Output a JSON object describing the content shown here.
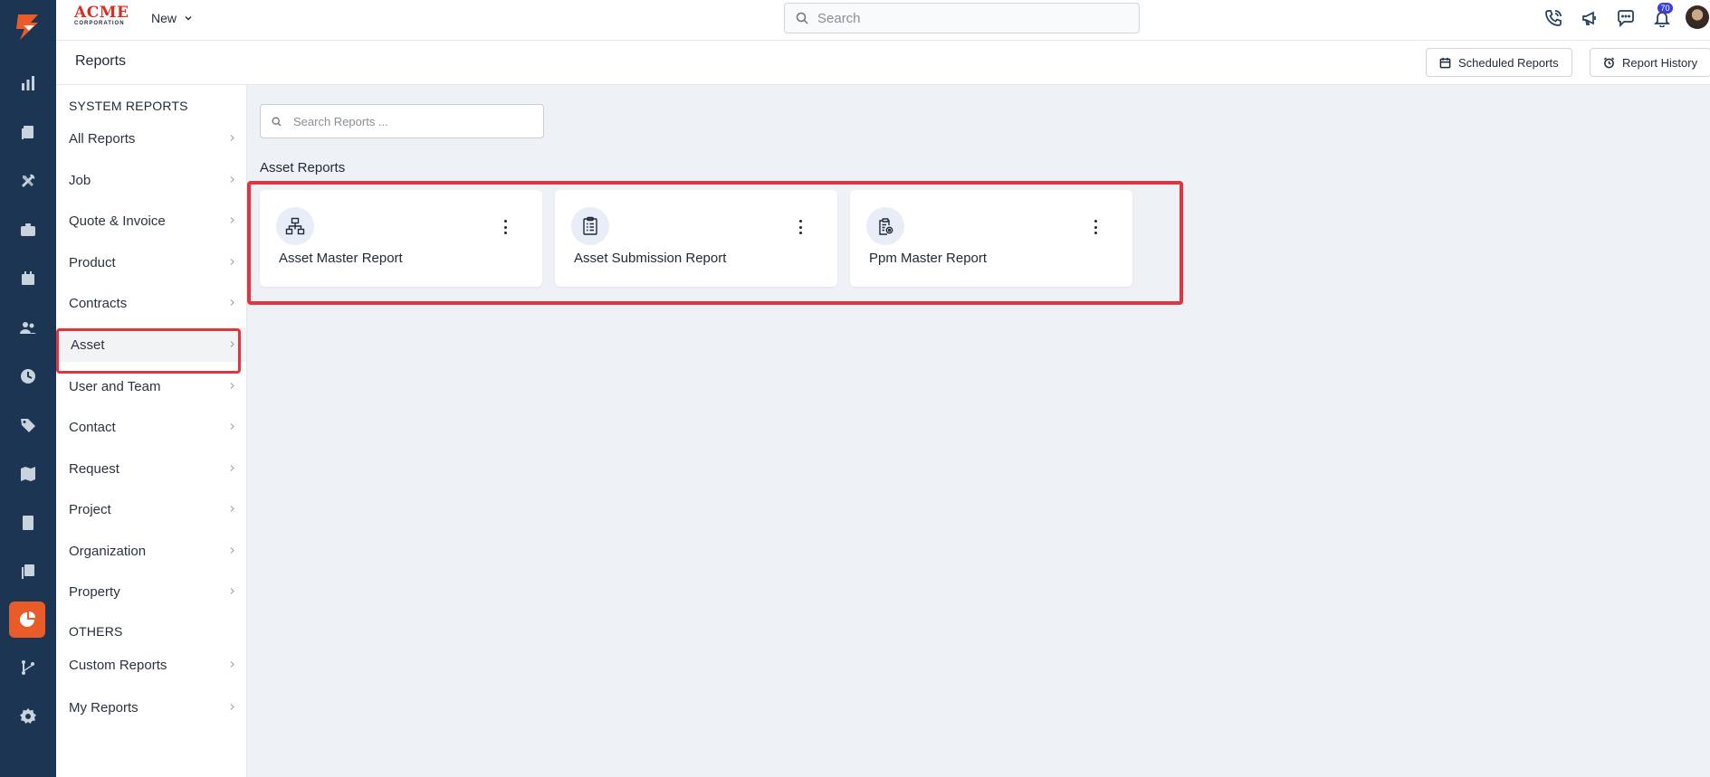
{
  "brand": {
    "name": "ACME",
    "sub": "CORPORATION"
  },
  "topbar": {
    "new_label": "New",
    "search_placeholder": "Search",
    "notification_count": "70"
  },
  "page": {
    "title": "Reports",
    "scheduled_reports_label": "Scheduled Reports",
    "report_history_label": "Report History"
  },
  "sidebar": {
    "system_header": "SYSTEM REPORTS",
    "others_header": "OTHERS",
    "system_items": [
      {
        "label": "All Reports"
      },
      {
        "label": "Job"
      },
      {
        "label": "Quote & Invoice"
      },
      {
        "label": "Product"
      },
      {
        "label": "Contracts"
      },
      {
        "label": "Asset"
      },
      {
        "label": "User and Team"
      },
      {
        "label": "Contact"
      },
      {
        "label": "Request"
      },
      {
        "label": "Project"
      },
      {
        "label": "Organization"
      },
      {
        "label": "Property"
      }
    ],
    "other_items": [
      {
        "label": "Custom Reports"
      },
      {
        "label": "My Reports"
      }
    ],
    "active_item": "Asset"
  },
  "main": {
    "search_placeholder": "Search Reports ...",
    "group_title": "Asset Reports",
    "cards": [
      {
        "name": "Asset Master Report",
        "icon": "hierarchy-icon"
      },
      {
        "name": "Asset Submission Report",
        "icon": "clipboard-list-icon"
      },
      {
        "name": "Ppm Master Report",
        "icon": "clipboard-settings-icon"
      }
    ]
  },
  "colors": {
    "rail_bg": "#1c3553",
    "accent": "#ea5b2a",
    "highlight": "#e0353f",
    "main_bg": "#eef1f6"
  }
}
